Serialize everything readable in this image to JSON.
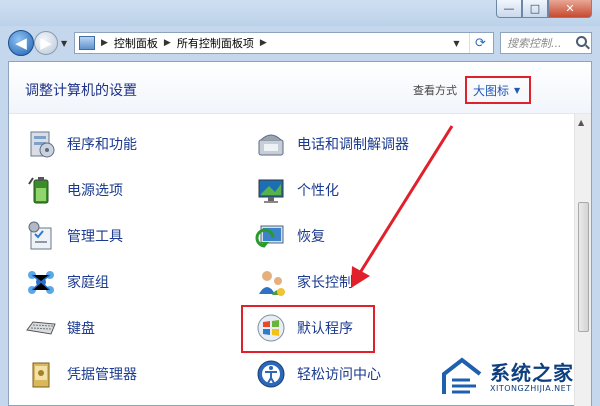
{
  "window": {
    "controls": {
      "minimize": "—",
      "maximize": "□",
      "close": "✕"
    }
  },
  "nav": {
    "back_icon": "◀",
    "forward_icon": "▶",
    "breadcrumb": [
      "控制面板",
      "所有控制面板项"
    ],
    "search_placeholder": "搜索控制..."
  },
  "header": {
    "title": "调整计算机的设置",
    "view_by_label": "查看方式",
    "view_by_value": "大图标"
  },
  "items_left": [
    {
      "label": "程序和功能",
      "icon": "programs-features-icon"
    },
    {
      "label": "电源选项",
      "icon": "power-options-icon"
    },
    {
      "label": "管理工具",
      "icon": "admin-tools-icon"
    },
    {
      "label": "家庭组",
      "icon": "homegroup-icon"
    },
    {
      "label": "键盘",
      "icon": "keyboard-icon"
    },
    {
      "label": "凭据管理器",
      "icon": "credential-manager-icon"
    }
  ],
  "items_right": [
    {
      "label": "电话和调制解调器",
      "icon": "phone-modem-icon"
    },
    {
      "label": "个性化",
      "icon": "personalization-icon"
    },
    {
      "label": "恢复",
      "icon": "recovery-icon"
    },
    {
      "label": "家长控制",
      "icon": "parental-controls-icon"
    },
    {
      "label": "默认程序",
      "icon": "default-programs-icon"
    },
    {
      "label": "轻松访问中心",
      "icon": "ease-of-access-icon"
    }
  ],
  "watermark": {
    "title": "系统之家",
    "subtitle": "XITONGZHIJIA.NET"
  },
  "colors": {
    "accent": "#1a3a8f",
    "highlight": "#e0202a",
    "link": "#1f56b8"
  }
}
